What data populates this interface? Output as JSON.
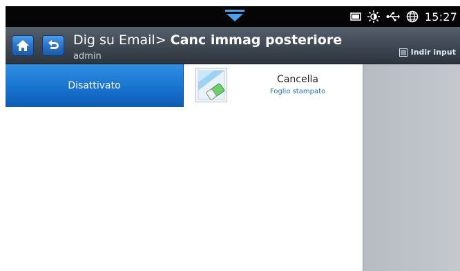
{
  "status_bar": {
    "time": "15:27",
    "icons": [
      "pull-down-tab-icon",
      "storage-icon",
      "brightness-icon",
      "usb-icon",
      "globe-icon"
    ]
  },
  "header": {
    "title_prefix": "Dig su Email> ",
    "title": "Canc immag posteriore",
    "user": "admin",
    "side_action": "Indir input",
    "nav": [
      "home-icon",
      "back-icon"
    ]
  },
  "options": {
    "off_label": "Disattivato",
    "erase_label": "Cancella",
    "erase_sublabel": "Foglio stampato",
    "selected": "off"
  },
  "colors": {
    "accent": "#1873cf",
    "status_bar": "#050505",
    "title_bar": "#424b56",
    "right_panel": "#c0c4c9",
    "sublabel": "#1a73c9"
  }
}
